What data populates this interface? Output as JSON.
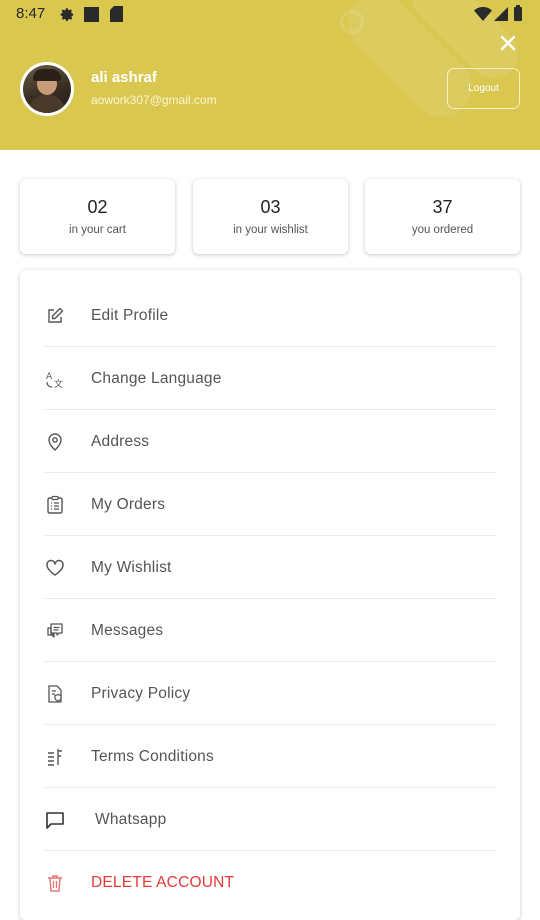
{
  "status_bar": {
    "time": "8:47",
    "icons": [
      "settings-icon",
      "square-icon",
      "sd-card-icon",
      "wifi-icon",
      "signal-icon",
      "battery-icon"
    ]
  },
  "colors": {
    "header_bg": "#d9c750",
    "danger": "#e53935",
    "text": "#555555"
  },
  "profile": {
    "name": "ali ashraf",
    "email": "aowork307@gmail.com",
    "logout_label": "Logout"
  },
  "stats": [
    {
      "value": "02",
      "label": "in your cart"
    },
    {
      "value": "03",
      "label": "in your wishlist"
    },
    {
      "value": "37",
      "label": "you ordered"
    }
  ],
  "menu": [
    {
      "label": "Edit Profile",
      "icon": "edit-icon"
    },
    {
      "label": "Change Language",
      "icon": "translate-icon"
    },
    {
      "label": "Address",
      "icon": "location-pin-icon"
    },
    {
      "label": "My Orders",
      "icon": "orders-list-icon"
    },
    {
      "label": "My Wishlist",
      "icon": "heart-icon"
    },
    {
      "label": "Messages",
      "icon": "chat-bubbles-icon"
    },
    {
      "label": "Privacy Policy",
      "icon": "privacy-document-icon"
    },
    {
      "label": "Terms Conditions",
      "icon": "terms-list-icon"
    },
    {
      "label": "Whatsapp",
      "icon": "message-square-icon"
    },
    {
      "label": "DELETE ACCOUNT",
      "icon": "trash-icon"
    }
  ]
}
